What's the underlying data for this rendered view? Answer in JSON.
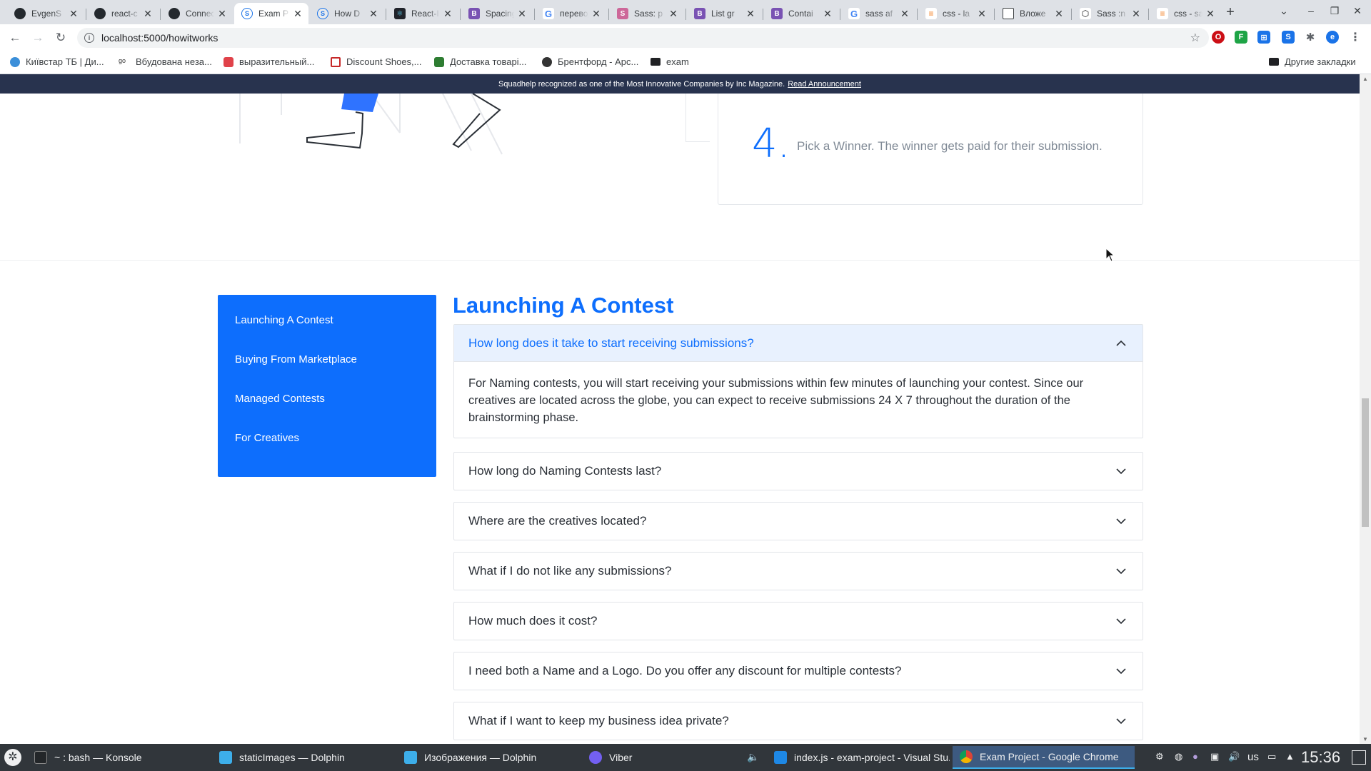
{
  "browser": {
    "tabs": [
      {
        "title": "EvgenS",
        "fav": "github"
      },
      {
        "title": "react-c",
        "fav": "github"
      },
      {
        "title": "Connect",
        "fav": "github"
      },
      {
        "title": "Exam P",
        "fav": "squadhelp",
        "active": true
      },
      {
        "title": "How D",
        "fav": "squadhelp"
      },
      {
        "title": "React-I",
        "fav": "react"
      },
      {
        "title": "Spacing",
        "fav": "bootstrap"
      },
      {
        "title": "перевод",
        "fav": "google"
      },
      {
        "title": "Sass: p",
        "fav": "sass"
      },
      {
        "title": "List gr",
        "fav": "bootstrap"
      },
      {
        "title": "Contai",
        "fav": "bootstrap"
      },
      {
        "title": "sass af",
        "fav": "google"
      },
      {
        "title": "css - la",
        "fav": "stackoverflow"
      },
      {
        "title": "Вложе",
        "fav": "chat"
      },
      {
        "title": "Sass :n",
        "fav": "codepen"
      },
      {
        "title": "css - sa",
        "fav": "stackoverflow"
      }
    ],
    "new_tab": "+",
    "url": "localhost:5000/howitworks",
    "profile_initial": "e",
    "bookmarks": [
      {
        "label": "Київстар ТБ | Ди..."
      },
      {
        "label": "Вбудована неза..."
      },
      {
        "label": "выразительный..."
      },
      {
        "label": "Discount Shoes,..."
      },
      {
        "label": "Доставка товарі..."
      },
      {
        "label": "Брентфорд - Арс..."
      },
      {
        "label": "exam"
      }
    ],
    "other_bookmarks": "Другие закладки"
  },
  "page": {
    "announcement": {
      "text": "Squadhelp recognized as one of the Most Innovative Companies by Inc Magazine.",
      "link": "Read Announcement"
    },
    "step": {
      "number": "4.",
      "text": "Pick a Winner. The winner gets paid for their submission."
    },
    "sidebar": {
      "items": [
        {
          "label": "Launching A Contest"
        },
        {
          "label": "Buying From Marketplace"
        },
        {
          "label": "Managed Contests"
        },
        {
          "label": "For Creatives"
        }
      ]
    },
    "faq": {
      "title": "Launching A Contest",
      "items": [
        {
          "question": "How long does it take to start receiving submissions?",
          "answer": "For Naming contests, you will start receiving your submissions within few minutes of launching your contest. Since our creatives are located across the globe, you can expect to receive submissions 24 X 7 throughout the duration of the brainstorming phase.",
          "expanded": true
        },
        {
          "question": "How long do Naming Contests last?",
          "expanded": false
        },
        {
          "question": "Where are the creatives located?",
          "expanded": false
        },
        {
          "question": "What if I do not like any submissions?",
          "expanded": false
        },
        {
          "question": "How much does it cost?",
          "expanded": false
        },
        {
          "question": "I need both a Name and a Logo. Do you offer any discount for multiple contests?",
          "expanded": false
        },
        {
          "question": "What if I want to keep my business idea private?",
          "expanded": false
        }
      ]
    },
    "colors": {
      "accent": "#0d6efd",
      "announcement_bg": "#28334e",
      "faq_open_bg": "#e8f1fe"
    }
  },
  "taskbar": {
    "items": [
      {
        "label": "~ : bash — Konsole"
      },
      {
        "label": "staticImages — Dolphin"
      },
      {
        "label": "Изображения — Dolphin"
      },
      {
        "label": "Viber"
      },
      {
        "label": "index.js - exam-project - Visual Stu..."
      },
      {
        "label": "Exam Project - Google Chrome",
        "active": true
      }
    ],
    "keyboard_layout": "us",
    "clock": "15:36"
  }
}
